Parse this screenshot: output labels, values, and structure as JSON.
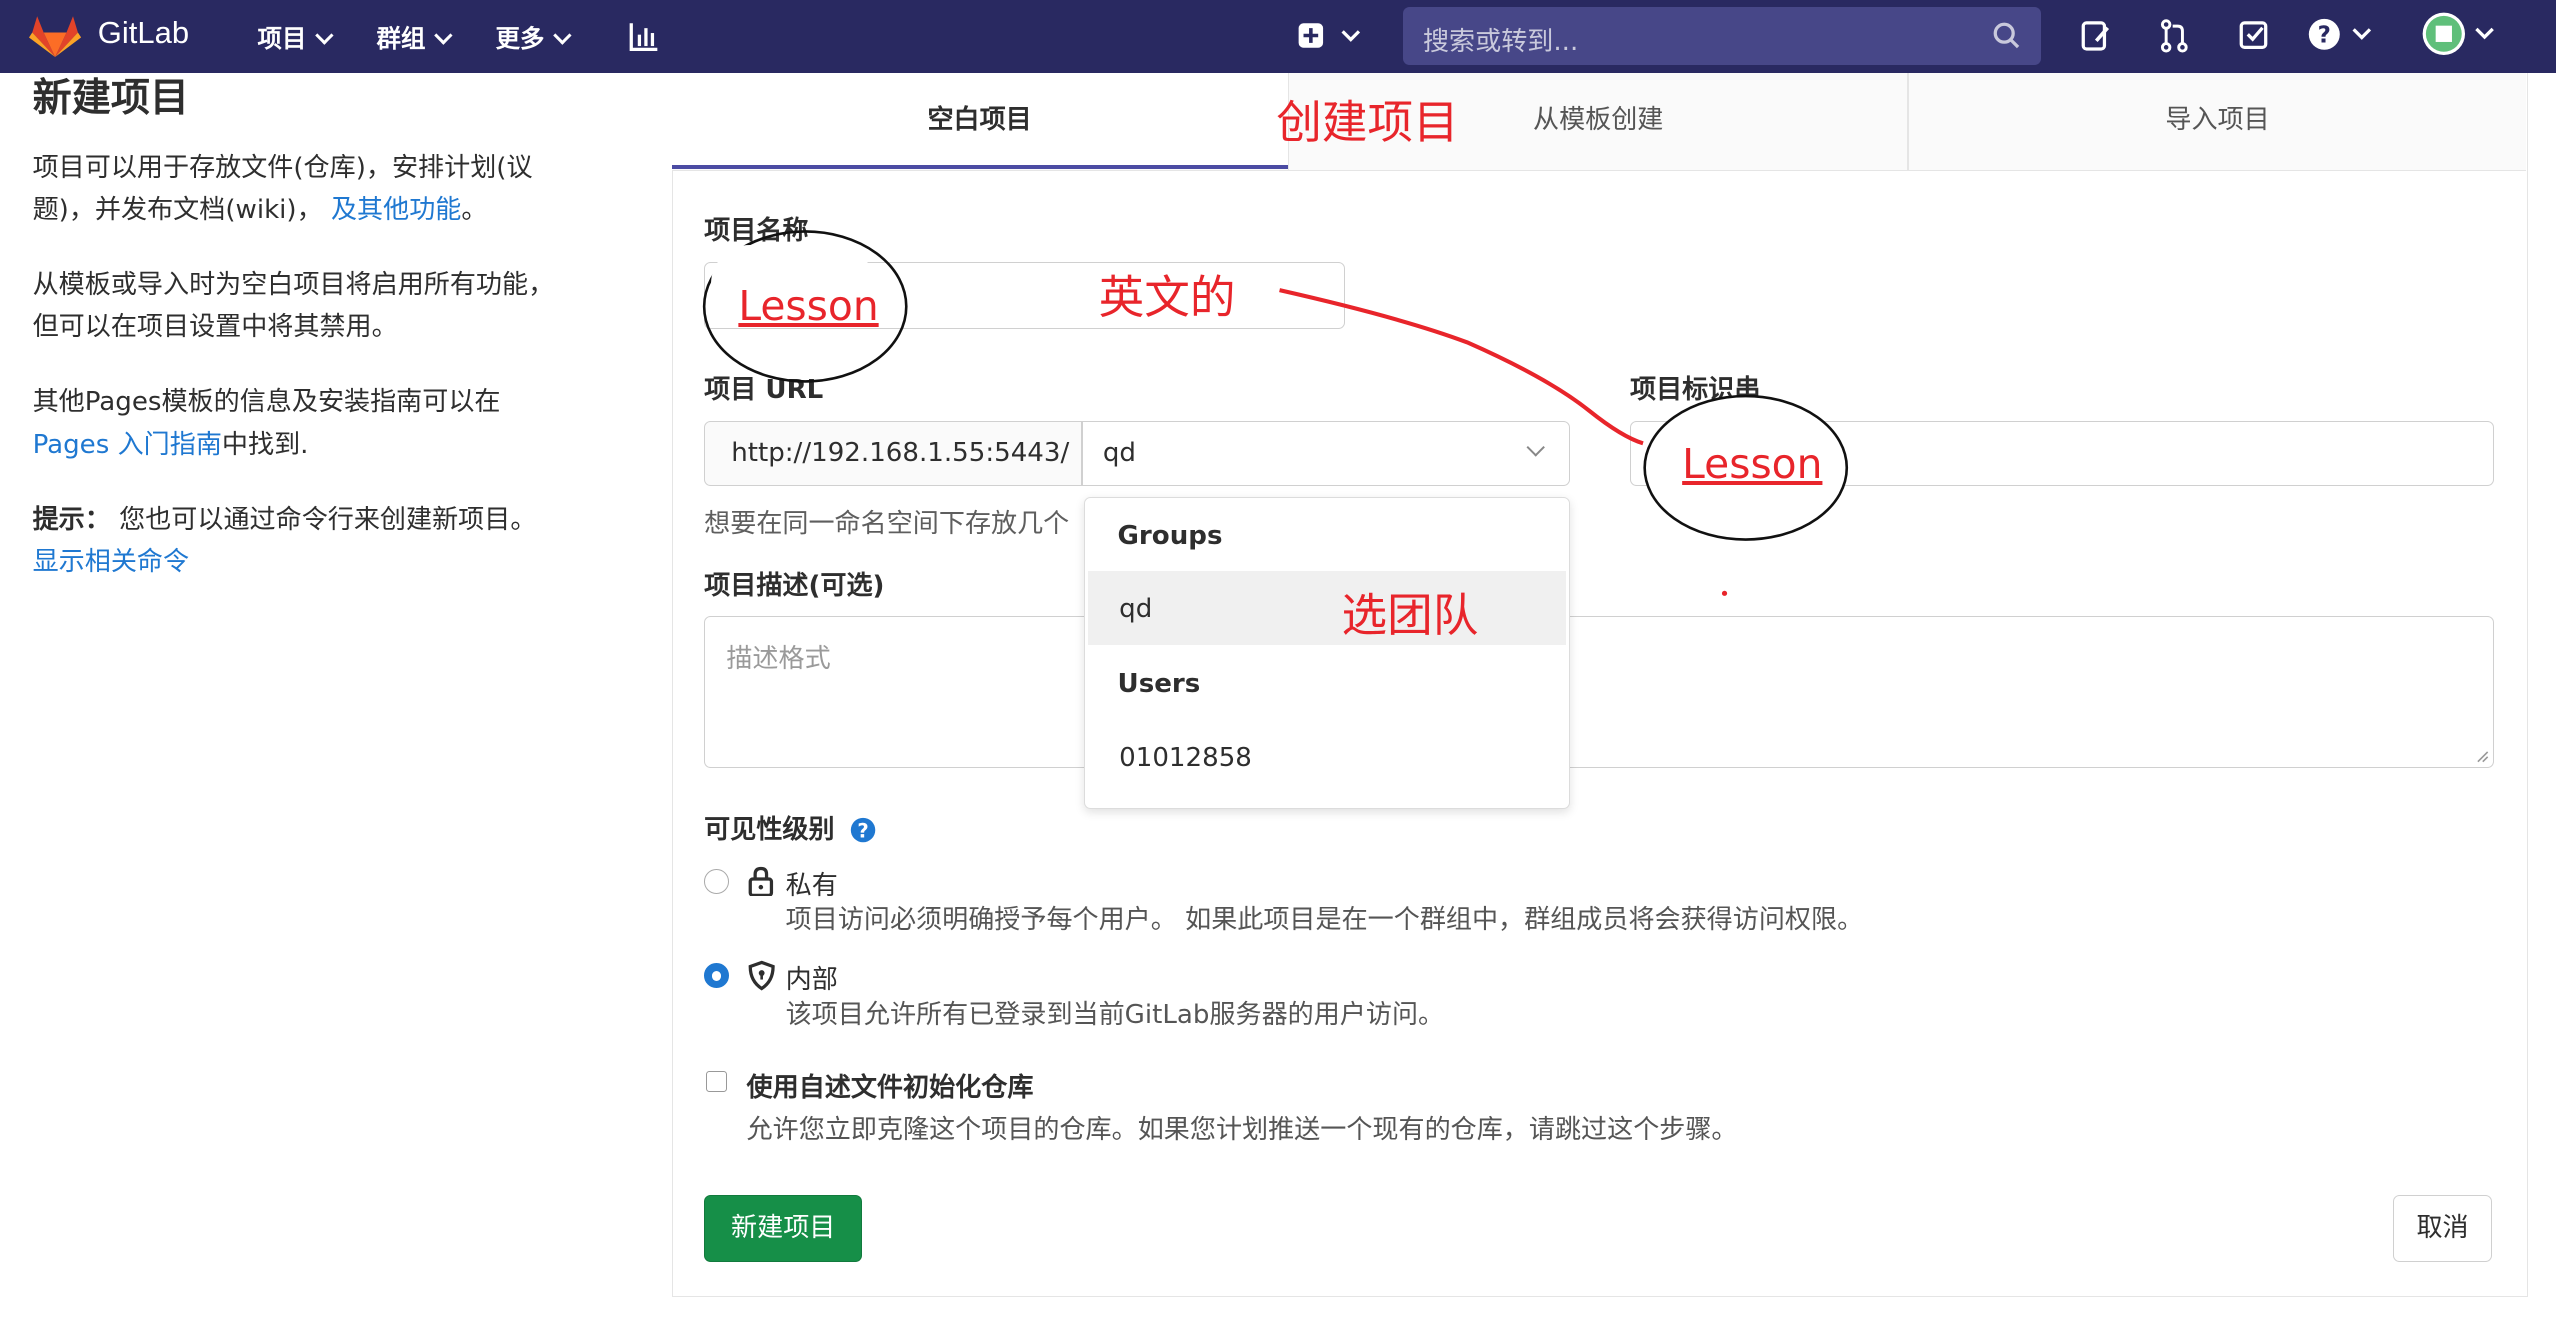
{
  "nav": {
    "brand": "GitLab",
    "projects": "项目",
    "groups": "群组",
    "more": "更多",
    "search_placeholder": "搜索或转到..."
  },
  "sidebar": {
    "title": "新建项目",
    "p1_a": "项目可以用于存放文件(仓库)，安排计划(议",
    "p1_b": "题)，并发布文档(wiki)，",
    "p1_link": "及其他功能",
    "p1_end": "。",
    "p2_a": "从模板或导入时为空白项目将启用所有功能，",
    "p2_b": "但可以在项目设置中将其禁用。",
    "p3_a": "其他Pages模板的信息及安装指南可以在",
    "p3_link": "Pages 入门指南",
    "p3_end": "中找到.",
    "tip_label": "提示：",
    "tip_text": "您也可以通过命令行来创建新项目。",
    "tip_link": "显示相关命令"
  },
  "tabs": {
    "blank": "空白项目",
    "template": "从模板创建",
    "import": "导入项目"
  },
  "form": {
    "name_label": "项目名称",
    "name_value": "",
    "url_label": "项目 URL",
    "url_prefix": "http://192.168.1.55:5443/",
    "namespace_value": "qd",
    "slug_label": "项目标识串",
    "help_text": "想要在同一命名空间下存放几个",
    "desc_label": "项目描述(可选)",
    "desc_placeholder": "描述格式",
    "visibility_label": "可见性级别",
    "private_title": "私有",
    "private_desc": "项目访问必须明确授予每个用户。 如果此项目是在一个群组中，群组成员将会获得访问权限。",
    "internal_title": "内部",
    "internal_desc": "该项目允许所有已登录到当前GitLab服务器的用户访问。",
    "init_title": "使用自述文件初始化仓库",
    "init_desc": "允许您立即克隆这个项目的仓库。如果您计划推送一个现有的仓库，请跳过这个步骤。",
    "create_button": "新建项目",
    "cancel_button": "取消",
    "selected_visibility": "internal"
  },
  "dropdown": {
    "groups_header": "Groups",
    "group_item": "qd",
    "users_header": "Users",
    "user_item": "01012858"
  },
  "annotations": {
    "create_project": "创建项目",
    "english": "英文的",
    "lesson_name": "Lesson",
    "lesson_slug": "Lesson",
    "select_team": "选团队"
  },
  "colors": {
    "navbar": "#292961",
    "link": "#1f78d1",
    "primary_button": "#168f48",
    "annotation": "#e8252b"
  }
}
